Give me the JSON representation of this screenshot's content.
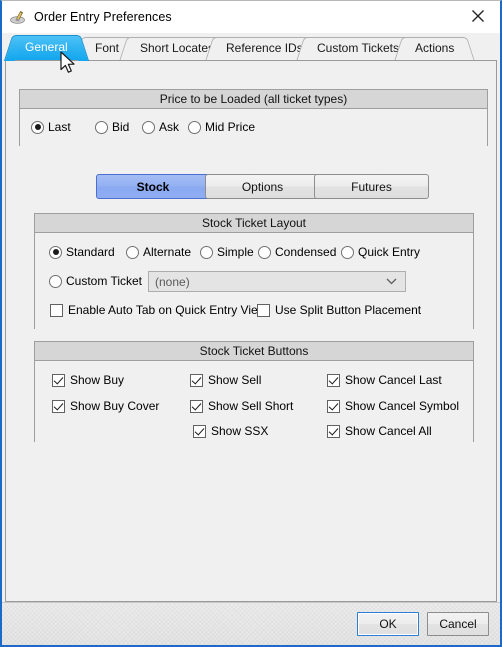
{
  "window": {
    "title": "Order Entry Preferences",
    "icon": "tools-icon",
    "close_label": "close-icon",
    "border_color": "#1b6ac9"
  },
  "tabs": {
    "active_index": 0,
    "items": [
      {
        "label": "General"
      },
      {
        "label": "Font"
      },
      {
        "label": "Short Locates"
      },
      {
        "label": "Reference IDs"
      },
      {
        "label": "Custom Tickets"
      },
      {
        "label": "Actions"
      }
    ]
  },
  "price_group": {
    "title": "Price to be Loaded (all ticket types)",
    "selected": "Last",
    "options": [
      {
        "label": "Last",
        "checked": true
      },
      {
        "label": "Bid",
        "checked": false
      },
      {
        "label": "Ask",
        "checked": false
      },
      {
        "label": "Mid Price",
        "checked": false
      }
    ]
  },
  "category_buttons": {
    "selected": "Stock",
    "items": [
      {
        "label": "Stock",
        "selected": true
      },
      {
        "label": "Options",
        "selected": false
      },
      {
        "label": "Futures",
        "selected": false
      }
    ]
  },
  "layout_group": {
    "title": "Stock Ticket Layout",
    "selected": "Standard",
    "options": [
      {
        "label": "Standard",
        "checked": true
      },
      {
        "label": "Alternate",
        "checked": false
      },
      {
        "label": "Simple",
        "checked": false
      },
      {
        "label": "Condensed",
        "checked": false
      },
      {
        "label": "Quick Entry",
        "checked": false
      }
    ],
    "custom_ticket": {
      "label": "Custom Ticket",
      "checked": false
    },
    "custom_ticket_value": "(none)",
    "checkboxes": [
      {
        "label": "Enable Auto Tab on Quick Entry View",
        "checked": false
      },
      {
        "label": "Use Split Button Placement",
        "checked": false
      }
    ]
  },
  "buttons_group": {
    "title": "Stock Ticket Buttons",
    "column1": [
      {
        "label": "Show Buy",
        "checked": true
      },
      {
        "label": "Show Buy Cover",
        "checked": true
      }
    ],
    "column2": [
      {
        "label": "Show Sell",
        "checked": true
      },
      {
        "label": "Show Sell Short",
        "checked": true
      },
      {
        "label": "Show SSX",
        "checked": true
      }
    ],
    "column3": [
      {
        "label": "Show Cancel Last",
        "checked": true
      },
      {
        "label": "Show Cancel Symbol",
        "checked": true
      },
      {
        "label": "Show Cancel All",
        "checked": true
      }
    ]
  },
  "dialog_buttons": {
    "ok": "OK",
    "cancel": "Cancel"
  }
}
